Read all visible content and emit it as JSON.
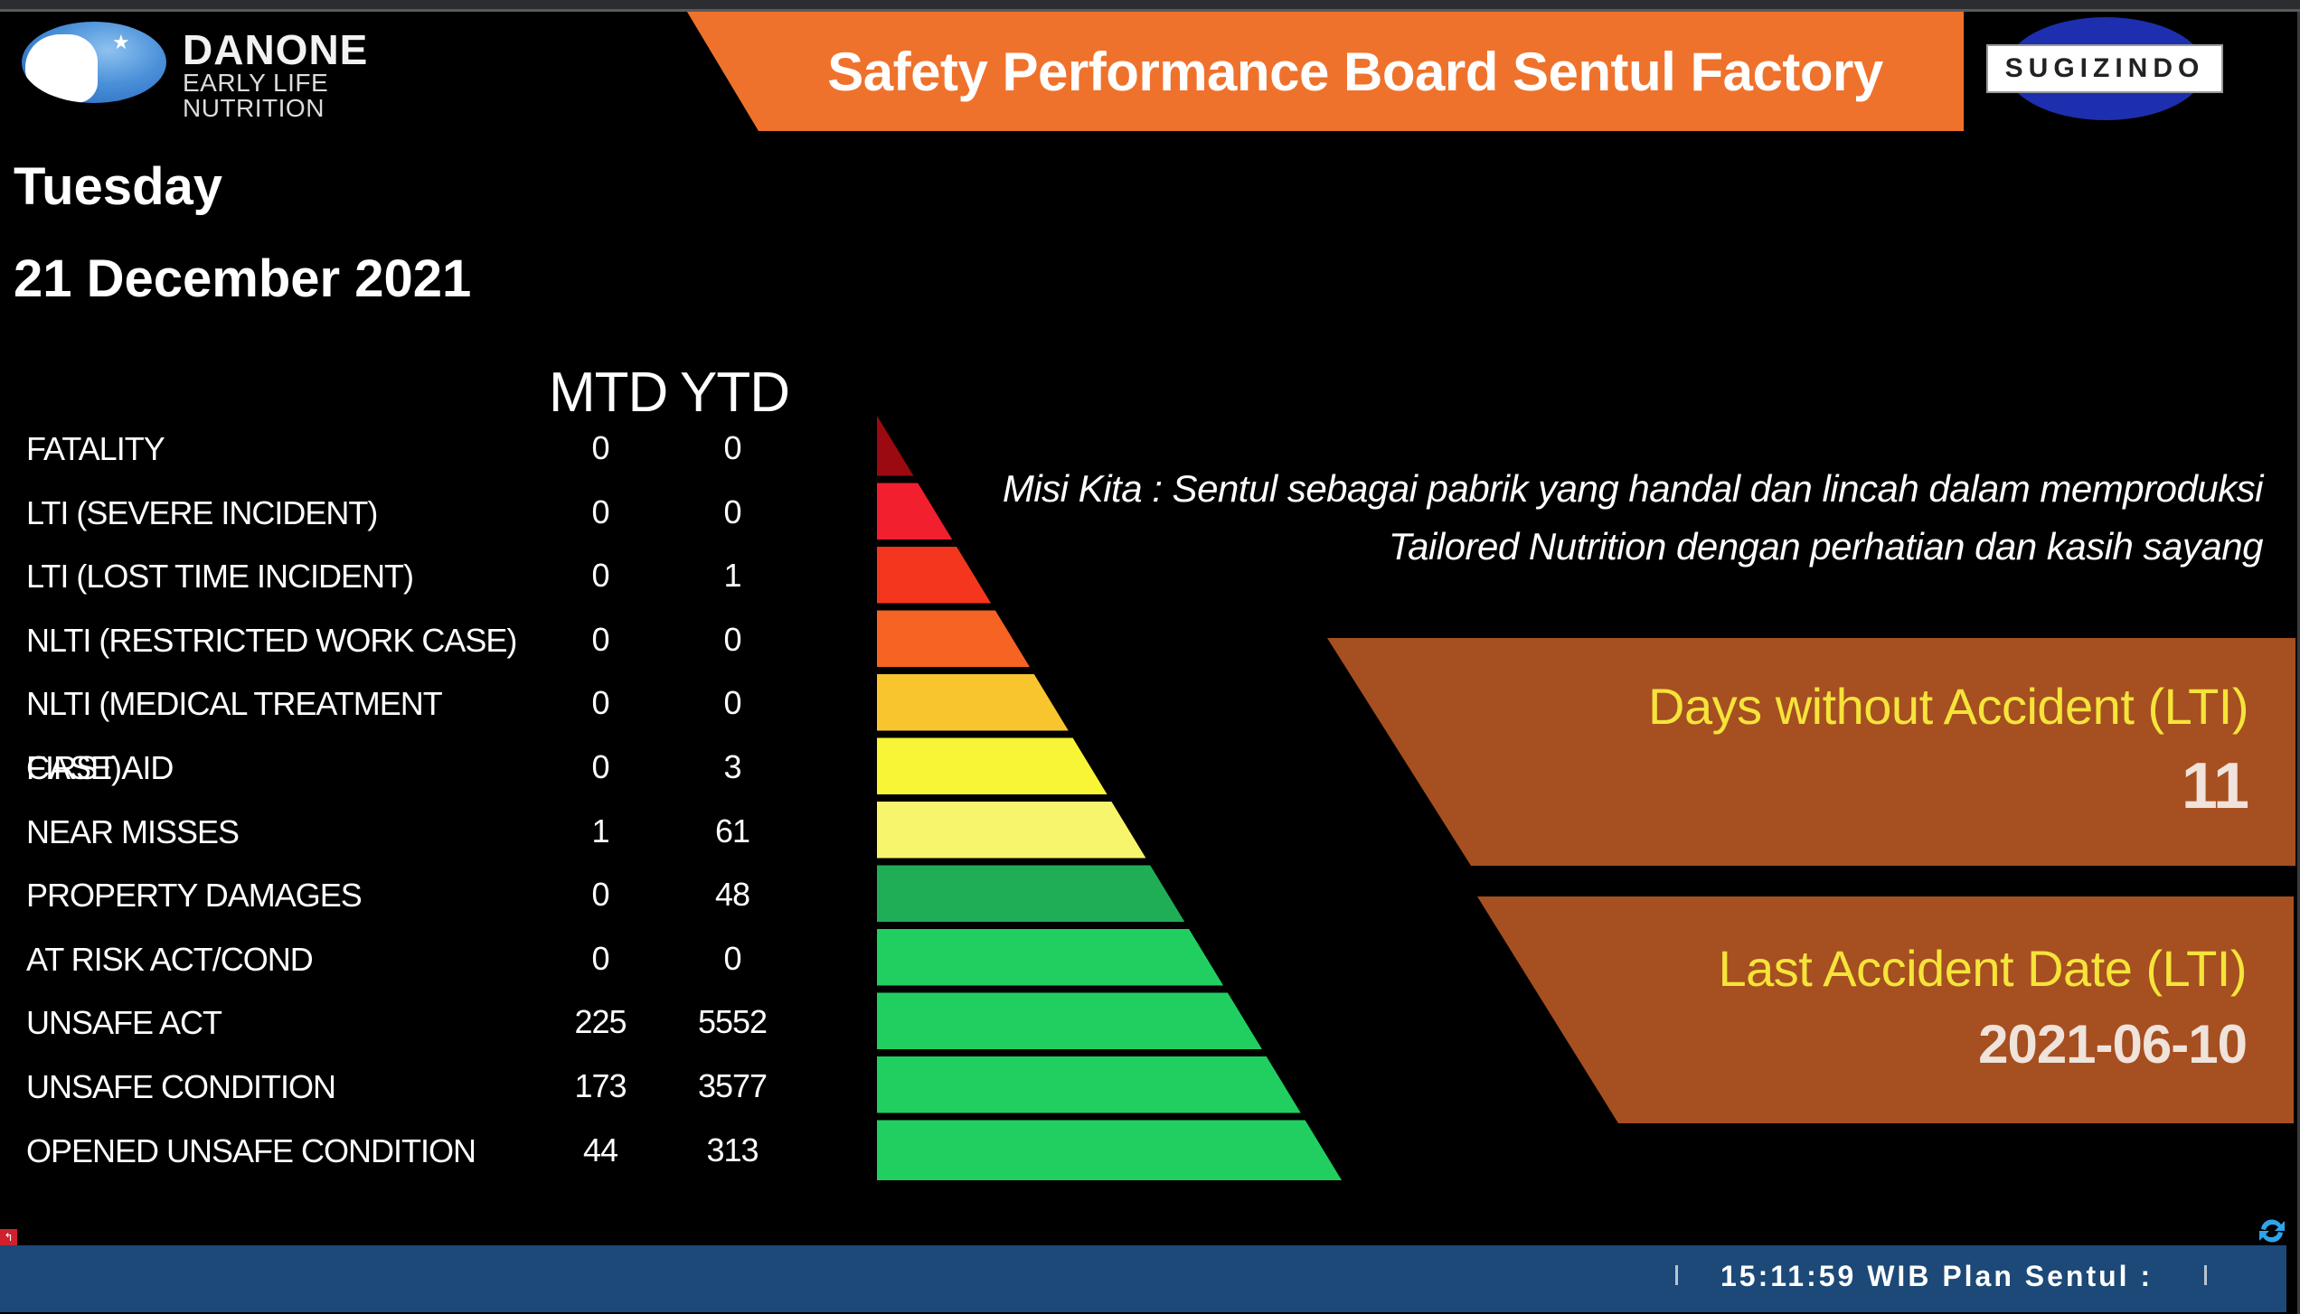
{
  "header": {
    "brand": {
      "name": "DANONE",
      "subtitle": "EARLY LIFE NUTRITION",
      "emblem_star": "★"
    },
    "title": "Safety Performance Board Sentul Factory",
    "partner_logo": "SUGIZINDO",
    "colors": {
      "banner": "#ef722c",
      "partner_oval": "#1d2fae"
    }
  },
  "date": {
    "day": "Tuesday",
    "full_date": "21 December 2021"
  },
  "stats_table": {
    "columns": [
      "MTD",
      "YTD"
    ],
    "rows": [
      {
        "label": "FATALITY",
        "mtd": "0",
        "ytd": "0"
      },
      {
        "label": "LTI (SEVERE INCIDENT)",
        "mtd": "0",
        "ytd": "0"
      },
      {
        "label": "LTI (LOST TIME INCIDENT)",
        "mtd": "0",
        "ytd": "1"
      },
      {
        "label": "NLTI (RESTRICTED WORK CASE)",
        "mtd": "0",
        "ytd": "0"
      },
      {
        "label": "NLTI (MEDICAL TREATMENT CASE)",
        "mtd": "0",
        "ytd": "0"
      },
      {
        "label": "FIRST AID",
        "mtd": "0",
        "ytd": "3"
      },
      {
        "label": "NEAR MISSES",
        "mtd": "1",
        "ytd": "61"
      },
      {
        "label": "PROPERTY DAMAGES",
        "mtd": "0",
        "ytd": "48"
      },
      {
        "label": "AT RISK ACT/COND",
        "mtd": "0",
        "ytd": "0"
      },
      {
        "label": "UNSAFE ACT",
        "mtd": "225",
        "ytd": "5552"
      },
      {
        "label": "UNSAFE CONDITION",
        "mtd": "173",
        "ytd": "3577"
      },
      {
        "label": "OPENED UNSAFE CONDITION",
        "mtd": "44",
        "ytd": "313"
      }
    ]
  },
  "pyramid": {
    "band_colors": [
      "#9b0a10",
      "#f21f2e",
      "#f5361f",
      "#f66322",
      "#f8c52e",
      "#f8f536",
      "#f7f56b",
      "#1fae56",
      "#21cf60",
      "#21cf60",
      "#21cf60",
      "#21cf60"
    ]
  },
  "mission": {
    "line1": "Misi Kita : Sentul sebagai pabrik yang handal dan lincah dalam memproduksi",
    "line2": "Tailored Nutrition dengan perhatian dan kasih sayang"
  },
  "panels": {
    "days_without_accident": {
      "title": "Days without Accident (LTI)",
      "value": "11"
    },
    "last_accident_date": {
      "title": "Last Accident Date (LTI)",
      "value": "2021-06-10"
    },
    "colors": {
      "background": "#a64f20",
      "title": "#f5e43a",
      "value": "#efe3db"
    }
  },
  "status_bar": {
    "text": "15:11:59 WIB Plan Sentul :",
    "back_icon": "back-arrow-icon",
    "refresh_icon": "refresh-icon",
    "color": "#1c4977"
  }
}
